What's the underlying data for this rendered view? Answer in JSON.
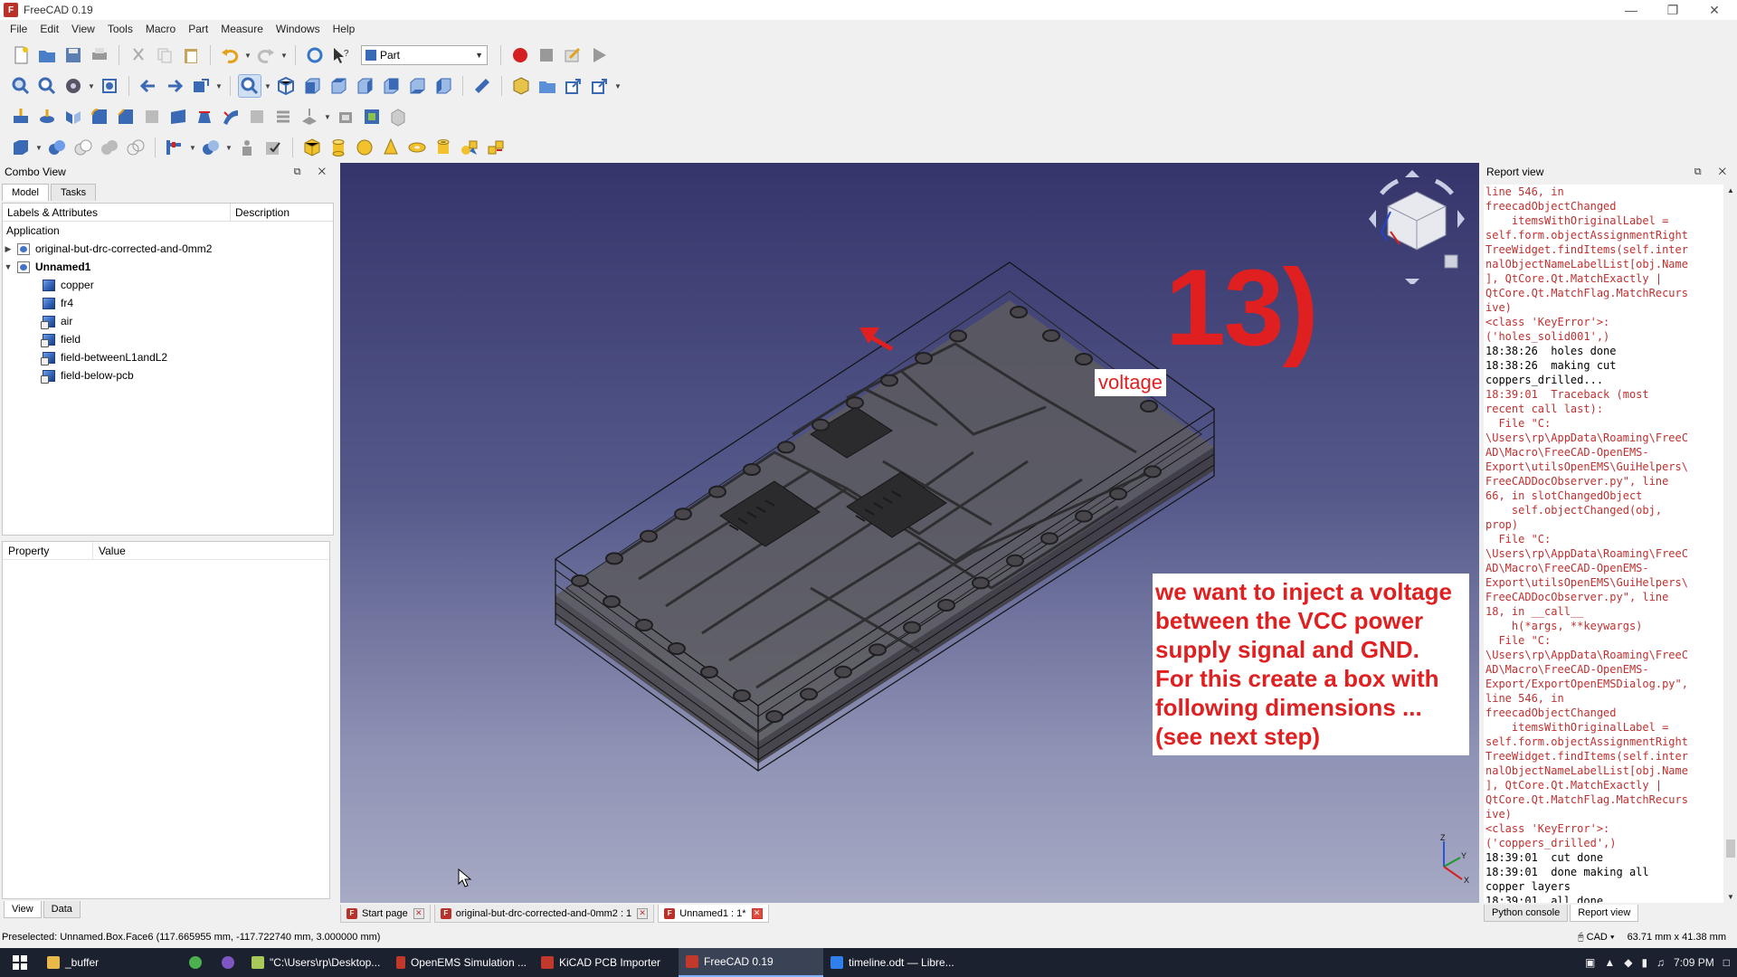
{
  "window": {
    "title": "FreeCAD 0.19",
    "app_icon": "freecad-icon"
  },
  "menu": [
    "File",
    "Edit",
    "View",
    "Tools",
    "Macro",
    "Part",
    "Measure",
    "Windows",
    "Help"
  ],
  "toolbar": {
    "workbench": "Part"
  },
  "combo_view": {
    "title": "Combo View",
    "tabs": [
      "Model",
      "Tasks"
    ],
    "tree": {
      "col_labels": "Labels & Attributes",
      "col_description": "Description",
      "section": "Application",
      "items": [
        {
          "label": "original-but-drc-corrected-and-0mm2",
          "level": 0,
          "expanded": false,
          "icon": "document-icon",
          "bold": false
        },
        {
          "label": "Unnamed1",
          "level": 0,
          "expanded": true,
          "icon": "document-icon",
          "bold": true
        },
        {
          "label": "copper",
          "level": 1,
          "icon": "box-icon"
        },
        {
          "label": "fr4",
          "level": 1,
          "icon": "box-icon"
        },
        {
          "label": "air",
          "level": 1,
          "icon": "box-link-icon"
        },
        {
          "label": "field",
          "level": 1,
          "icon": "box-link-icon"
        },
        {
          "label": "field-betweenL1andL2",
          "level": 1,
          "icon": "box-link-icon"
        },
        {
          "label": "field-below-pcb",
          "level": 1,
          "icon": "box-link-icon"
        }
      ]
    },
    "property": {
      "col_property": "Property",
      "col_value": "Value"
    },
    "bottom_tabs": [
      "View",
      "Data"
    ]
  },
  "viewport": {
    "step_number": "13)",
    "voltage_label": "voltage",
    "note_lines": [
      "we want to inject a voltage",
      "between the VCC power",
      "supply signal and GND.",
      "For this create a box with",
      "following dimensions ...",
      "(see next step)"
    ],
    "axis": {
      "z": "Z",
      "y": "Y",
      "x": "X"
    },
    "colors": {
      "annotation": "#e02020"
    }
  },
  "doc_tabs": [
    {
      "label": "Start page",
      "active": false
    },
    {
      "label": "original-but-drc-corrected-and-0mm2 : 1",
      "active": false
    },
    {
      "label": "Unnamed1 : 1*",
      "active": true
    }
  ],
  "report_view": {
    "title": "Report view",
    "lines": [
      {
        "t": "line 546, in",
        "err": true
      },
      {
        "t": "freecadObjectChanged",
        "err": true
      },
      {
        "t": "    itemsWithOriginalLabel =",
        "err": true
      },
      {
        "t": "self.form.objectAssignmentRight",
        "err": true
      },
      {
        "t": "TreeWidget.findItems(self.inter",
        "err": true
      },
      {
        "t": "nalObjectNameLabelList[obj.Name",
        "err": true
      },
      {
        "t": "], QtCore.Qt.MatchExactly |",
        "err": true
      },
      {
        "t": "QtCore.Qt.MatchFlag.MatchRecurs",
        "err": true
      },
      {
        "t": "ive)",
        "err": true
      },
      {
        "t": "<class 'KeyError'>:",
        "err": true
      },
      {
        "t": "('holes_solid001',)",
        "err": true
      },
      {
        "t": "18:38:26  holes done",
        "err": false
      },
      {
        "t": "18:38:26  making cut",
        "err": false
      },
      {
        "t": "coppers_drilled...",
        "err": false
      },
      {
        "t": "18:39:01  Traceback (most",
        "err": true
      },
      {
        "t": "recent call last):",
        "err": true
      },
      {
        "t": "  File \"C:",
        "err": true
      },
      {
        "t": "\\Users\\rp\\AppData\\Roaming\\FreeC",
        "err": true
      },
      {
        "t": "AD\\Macro\\FreeCAD-OpenEMS-",
        "err": true
      },
      {
        "t": "Export\\utilsOpenEMS\\GuiHelpers\\",
        "err": true
      },
      {
        "t": "FreeCADDocObserver.py\", line",
        "err": true
      },
      {
        "t": "66, in slotChangedObject",
        "err": true
      },
      {
        "t": "    self.objectChanged(obj,",
        "err": true
      },
      {
        "t": "prop)",
        "err": true
      },
      {
        "t": "  File \"C:",
        "err": true
      },
      {
        "t": "\\Users\\rp\\AppData\\Roaming\\FreeC",
        "err": true
      },
      {
        "t": "AD\\Macro\\FreeCAD-OpenEMS-",
        "err": true
      },
      {
        "t": "Export\\utilsOpenEMS\\GuiHelpers\\",
        "err": true
      },
      {
        "t": "FreeCADDocObserver.py\", line",
        "err": true
      },
      {
        "t": "18, in __call__",
        "err": true
      },
      {
        "t": "    h(*args, **keywargs)",
        "err": true
      },
      {
        "t": "  File \"C:",
        "err": true
      },
      {
        "t": "\\Users\\rp\\AppData\\Roaming\\FreeC",
        "err": true
      },
      {
        "t": "AD\\Macro\\FreeCAD-OpenEMS-",
        "err": true
      },
      {
        "t": "Export/ExportOpenEMSDialog.py\",",
        "err": true
      },
      {
        "t": "line 546, in",
        "err": true
      },
      {
        "t": "freecadObjectChanged",
        "err": true
      },
      {
        "t": "    itemsWithOriginalLabel =",
        "err": true
      },
      {
        "t": "self.form.objectAssignmentRight",
        "err": true
      },
      {
        "t": "TreeWidget.findItems(self.inter",
        "err": true
      },
      {
        "t": "nalObjectNameLabelList[obj.Name",
        "err": true
      },
      {
        "t": "], QtCore.Qt.MatchExactly |",
        "err": true
      },
      {
        "t": "QtCore.Qt.MatchFlag.MatchRecurs",
        "err": true
      },
      {
        "t": "ive)",
        "err": true
      },
      {
        "t": "<class 'KeyError'>:",
        "err": true
      },
      {
        "t": "('coppers_drilled',)",
        "err": true
      },
      {
        "t": "18:39:01  cut done",
        "err": false
      },
      {
        "t": "18:39:01  done making all",
        "err": false
      },
      {
        "t": "copper layers",
        "err": false
      },
      {
        "t": "18:39:01  all done",
        "err": false
      }
    ],
    "bottom_tabs": [
      "Python console",
      "Report view"
    ]
  },
  "status": {
    "preselected": "Preselected: Unnamed.Box.Face6 (117.665955 mm, -117.722740 mm, 3.000000 mm)",
    "nav_style": "CAD",
    "dimensions": "63.71 mm x 41.38 mm"
  },
  "taskbar": {
    "items": [
      {
        "label": "_buffer",
        "icon": "folder-icon",
        "color": "#e8b84a",
        "active": false
      },
      {
        "label": "",
        "icon": "chrome-icon",
        "color": "#4caf50",
        "active": false
      },
      {
        "label": "",
        "icon": "obs-icon",
        "color": "#7e57c2",
        "active": false
      },
      {
        "label": "\"C:\\Users\\rp\\Desktop...",
        "icon": "notepad-icon",
        "color": "#a7c957",
        "active": false
      },
      {
        "label": "OpenEMS Simulation ...",
        "icon": "freecad-icon",
        "color": "#c0392b",
        "active": false
      },
      {
        "label": "KiCAD PCB Importer",
        "icon": "freecad-icon",
        "color": "#c0392b",
        "active": false
      },
      {
        "label": "FreeCAD 0.19",
        "icon": "freecad-icon",
        "color": "#c0392b",
        "active": true
      },
      {
        "label": "timeline.odt — Libre...",
        "icon": "writer-icon",
        "color": "#2f80ed",
        "active": false
      }
    ],
    "time": "7:09 PM"
  }
}
